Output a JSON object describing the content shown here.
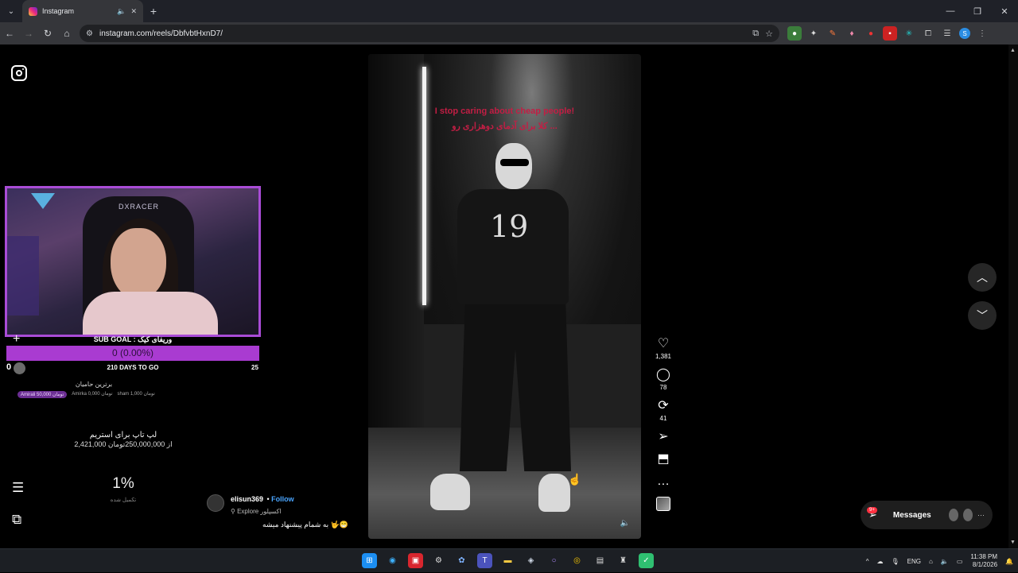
{
  "browser": {
    "tab_title": "Instagram",
    "url": "instagram.com/reels/DbfvbtHxnD7/",
    "window_controls": [
      "—",
      "❐",
      "✕"
    ]
  },
  "stream_overlay": {
    "chair_brand": "DXRACER",
    "sub_goal_title": "SUB GOAL : وریفای کیک",
    "sub_goal_value": "0 (0.00%)",
    "sub_goal_start": "0",
    "days_to_go": "210 DAYS TO GO",
    "sub_goal_target": "25",
    "top_donors_title": "برترین حامیان",
    "top_donors": [
      "Amirali 50,000 تومان",
      "Amirka 0,000 تومان",
      "sham 1,000 تومان"
    ],
    "donate_title": "لپ تاپ برای استریم",
    "donate_amount": "2,421,000 از 250,000,000تومان",
    "percent": "1%",
    "percent_label": "تکمیل شده"
  },
  "reel": {
    "caption_en": "I stop caring about cheap people!",
    "caption_fa": "کلا برای آدمای دوهزاری رو ...",
    "shirt_text": "19",
    "author": "elisun369",
    "follow": "Follow",
    "location": "Explore اکسپلور",
    "caption": "به شمام پیشنهاد میشه 🤟😁",
    "likes": "1,381",
    "comments": "78",
    "reposts": "41"
  },
  "messages": {
    "label": "Messages",
    "badge": "9+"
  },
  "taskbar": {
    "lang": "ENG",
    "time": "11:38 PM",
    "date": "8/1/2026"
  }
}
